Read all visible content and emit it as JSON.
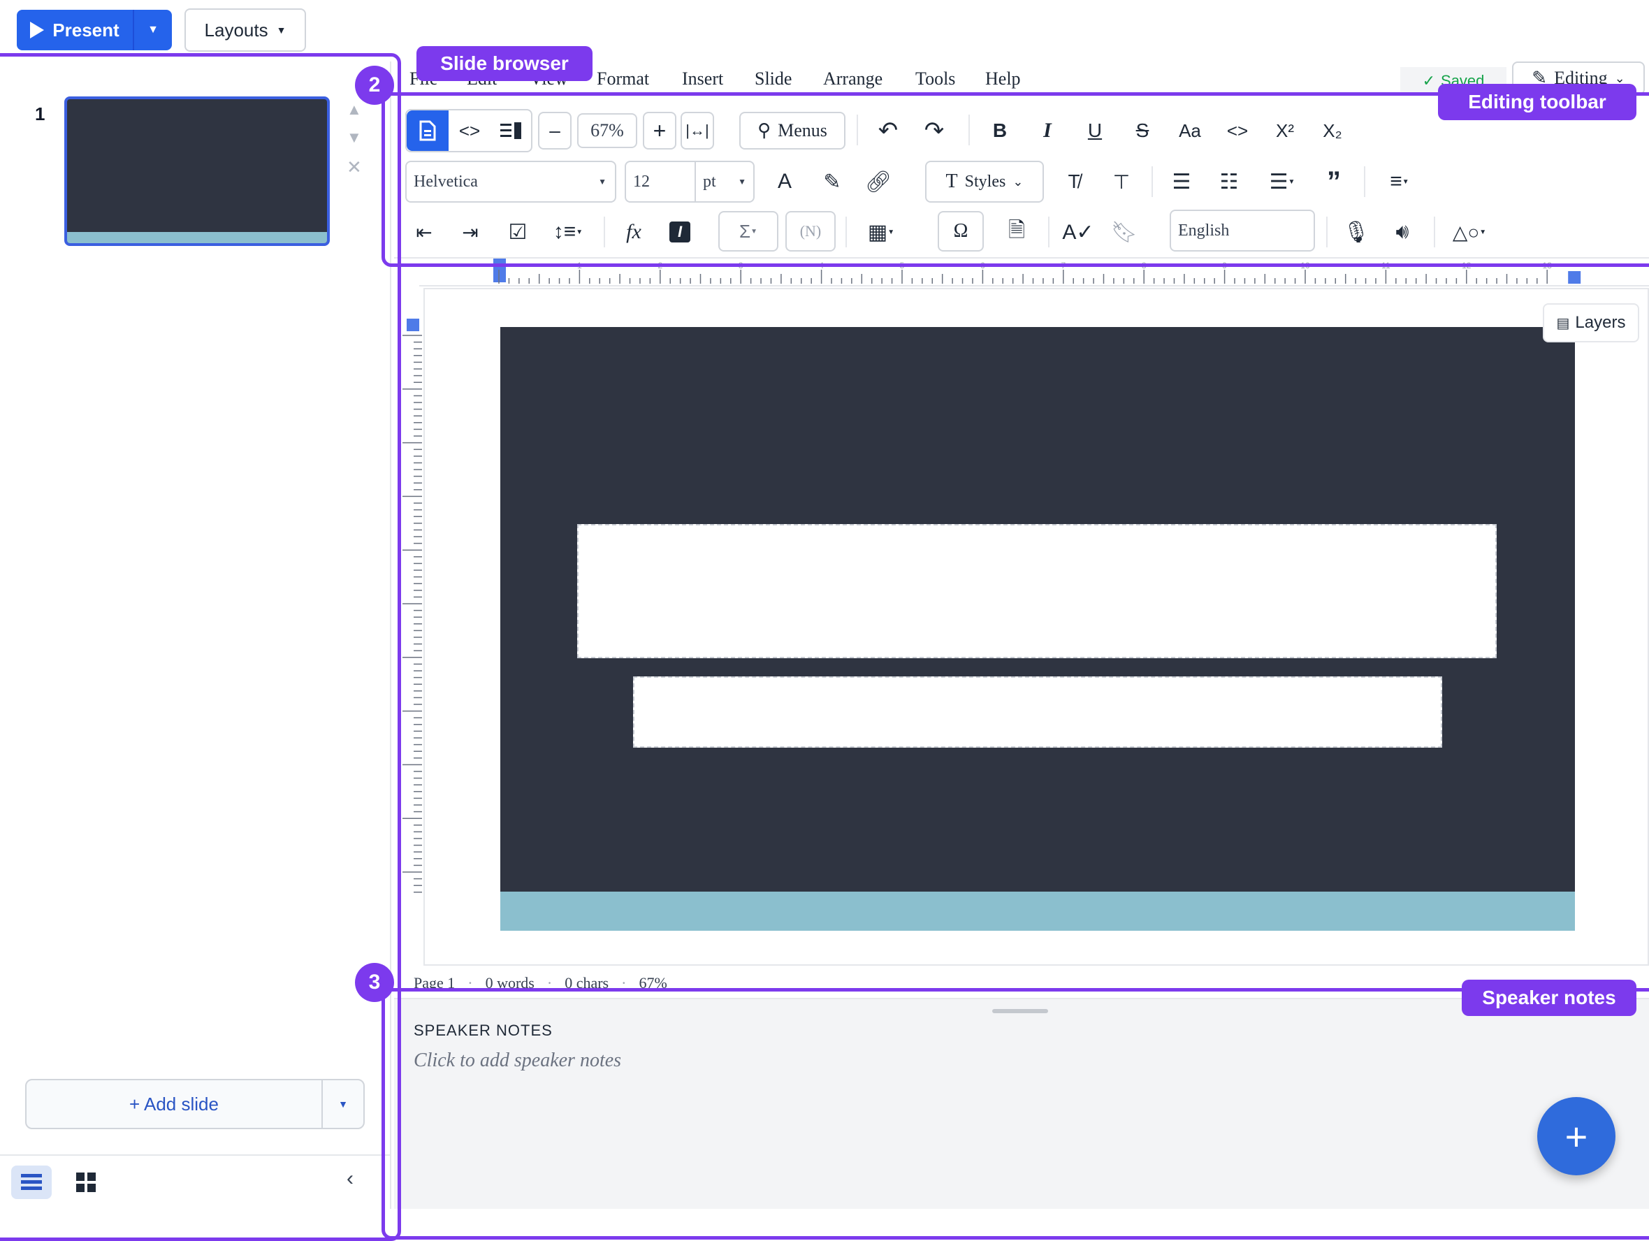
{
  "header": {
    "present_label": "Present",
    "layouts_label": "Layouts"
  },
  "sidebar": {
    "slides": [
      {
        "number": "1"
      }
    ],
    "add_slide_label": "+ Add slide"
  },
  "menubar": {
    "items": [
      "File",
      "Edit",
      "View",
      "Format",
      "Insert",
      "Slide",
      "Arrange",
      "Tools",
      "Help"
    ],
    "saved_label": "Saved",
    "editing_label": "Editing"
  },
  "toolbar": {
    "zoom_value": "67%",
    "menus_label": "Menus",
    "font_family": "Helvetica",
    "font_size": "12",
    "font_unit": "pt",
    "styles_label": "Styles",
    "language": "English"
  },
  "canvas": {
    "layers_label": "Layers",
    "slide_background": "#2f3441",
    "slide_band": "#8bbfce",
    "ruler_h_ticks": [
      "1",
      "2",
      "3",
      "4",
      "5",
      "6",
      "7",
      "8",
      "9",
      "10",
      "11",
      "12",
      "13"
    ]
  },
  "statusbar": {
    "page": "Page 1",
    "words": "0 words",
    "chars": "0 chars",
    "zoom": "67%"
  },
  "notes": {
    "title": "SPEAKER NOTES",
    "placeholder": "Click to add speaker notes"
  },
  "annotations": {
    "slide_browser": "Slide browser",
    "editing_toolbar": "Editing toolbar",
    "speaker_notes": "Speaker notes",
    "num_2": "2",
    "num_3": "3",
    "accent": "#7c3aed"
  }
}
